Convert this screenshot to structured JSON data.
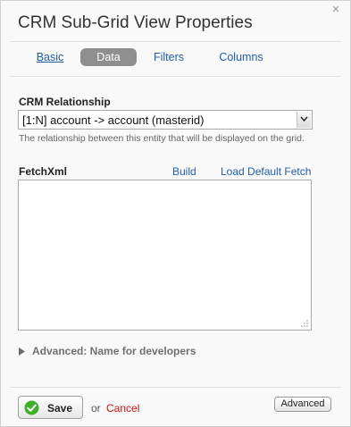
{
  "dialog": {
    "title": "CRM Sub-Grid View Properties",
    "close_glyph": "×"
  },
  "tabs": [
    {
      "label": "Basic",
      "active": false
    },
    {
      "label": "Data",
      "active": true
    },
    {
      "label": "Filters",
      "active": false
    },
    {
      "label": "Columns",
      "active": false
    }
  ],
  "relationship": {
    "label": "CRM Relationship",
    "value": "[1:N] account -> account (masterid)",
    "help": "The relationship between this entity that will be displayed on the grid."
  },
  "fetchxml": {
    "label": "FetchXml",
    "build_link": "Build",
    "load_default_link": "Load Default Fetch",
    "value": ""
  },
  "advanced_section": {
    "label": "Advanced: Name for developers"
  },
  "footer": {
    "save_label": "Save",
    "or_text": "or",
    "cancel_label": "Cancel",
    "advanced_label": "Advanced"
  },
  "colors": {
    "link": "#1f5ea8",
    "active_tab_bg": "#8f8f8f",
    "cancel": "#cc1111",
    "save_icon": "#3fae2a"
  },
  "icons": {
    "close": "close-icon",
    "dropdown": "chevron-down-icon",
    "resize": "resize-grip-icon",
    "expand": "triangle-right-icon",
    "save": "checkmark-icon"
  }
}
